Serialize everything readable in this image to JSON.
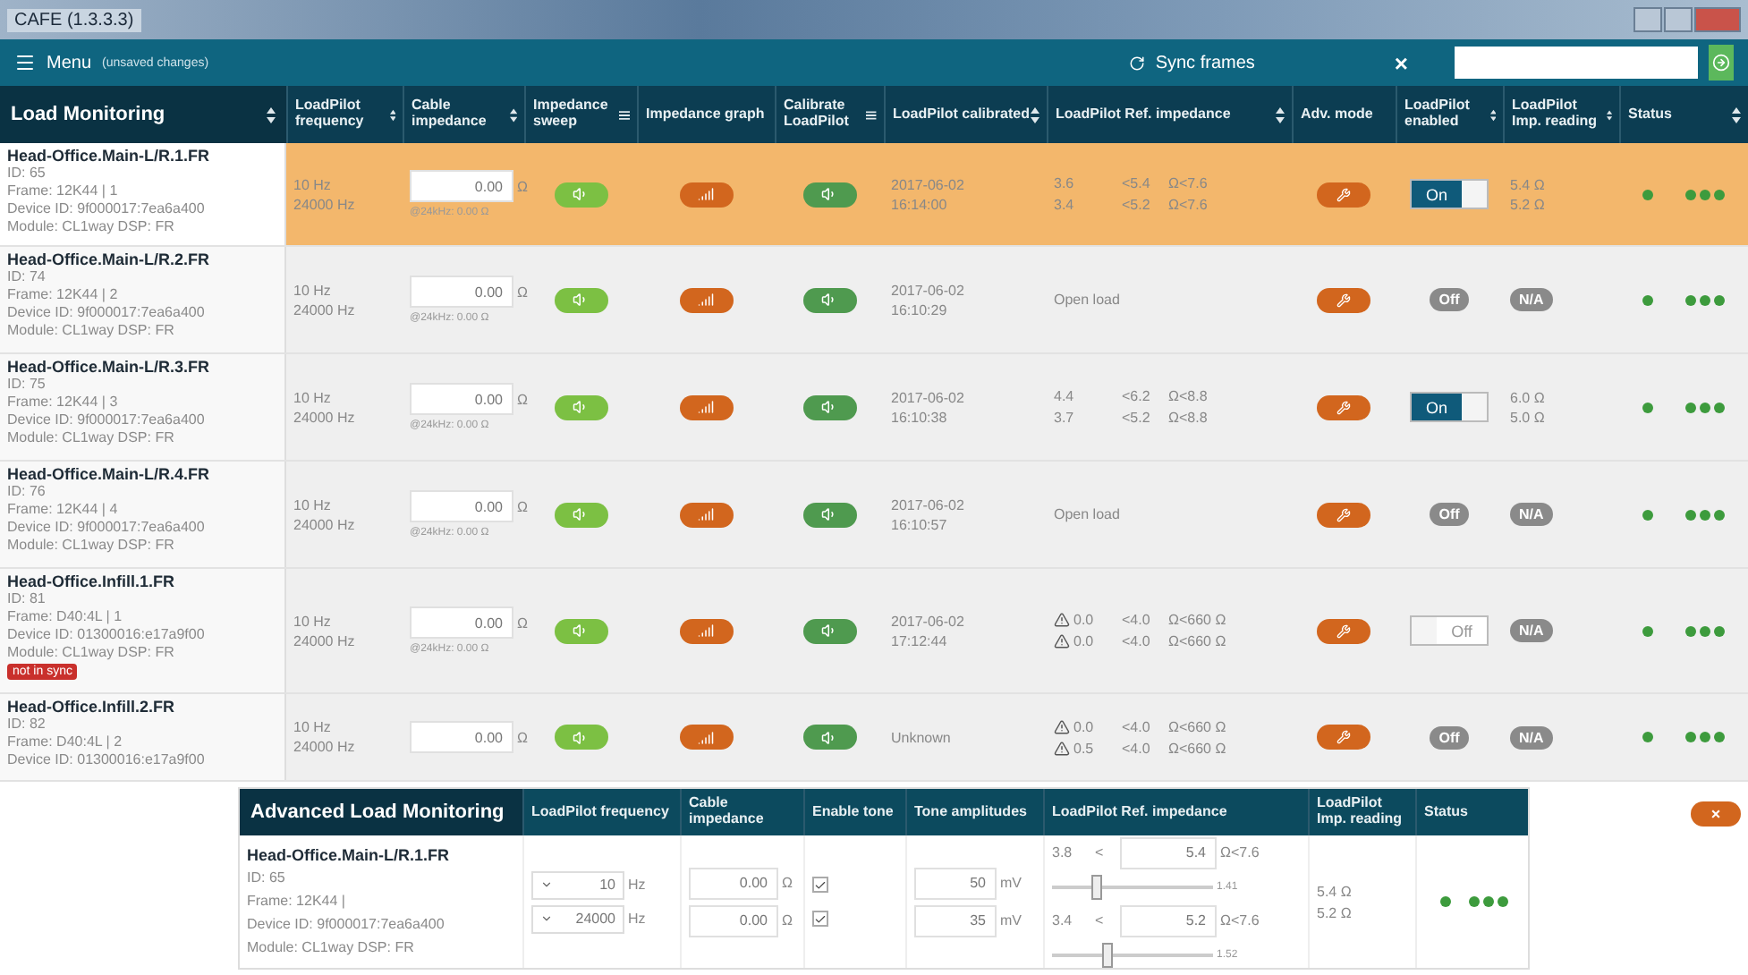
{
  "window": {
    "title": "CAFE (1.3.3.3)"
  },
  "toolbar": {
    "menu": "Menu",
    "note": "(unsaved changes)",
    "sync": "Sync frames",
    "clear": "×"
  },
  "table": {
    "title": "Load Monitoring",
    "columns": [
      {
        "label": "LoadPilot frequency",
        "kind": "sortable"
      },
      {
        "label": "Cable impedance",
        "kind": "sortable"
      },
      {
        "label": "Impedance sweep",
        "kind": "action"
      },
      {
        "label": "Impedance graph",
        "kind": "plain"
      },
      {
        "label": "Calibrate LoadPilot",
        "kind": "action"
      },
      {
        "label": "LoadPilot calibrated",
        "kind": "sortable"
      },
      {
        "label": "LoadPilot Ref. impedance",
        "kind": "sortable"
      },
      {
        "label": "Adv. mode",
        "kind": "plain"
      },
      {
        "label": "LoadPilot enabled",
        "kind": "sortable"
      },
      {
        "label": "LoadPilot Imp. reading",
        "kind": "sortable"
      },
      {
        "label": "Status",
        "kind": "sortable"
      }
    ],
    "rows": [
      {
        "selected": true,
        "name": "Head-Office.Main-L/R.1.FR",
        "details": [
          "ID: 65",
          "Frame: 12K44 | 1",
          "Device ID: 9f000017:7ea6a400",
          "Module: CL1way DSP: FR"
        ],
        "freq": [
          "10 Hz",
          "24000 Hz"
        ],
        "cable": "0.00",
        "cable_unit": "Ω",
        "cable_hint": "@24kHz: 0.00 Ω",
        "calibrated": [
          "2017-06-02",
          "16:14:00"
        ],
        "ref": {
          "kind": "values",
          "lines": [
            {
              "warn": false,
              "min": "3.6",
              "nom": "<5.4",
              "max": "Ω<7.6"
            },
            {
              "warn": false,
              "min": "3.4",
              "nom": "<5.2",
              "max": "Ω<7.6"
            }
          ]
        },
        "enabled": {
          "kind": "switch",
          "on": true,
          "label": "On"
        },
        "reading": {
          "kind": "values",
          "lines": [
            "5.4 Ω",
            "5.2 Ω"
          ]
        }
      },
      {
        "selected": false,
        "name": "Head-Office.Main-L/R.2.FR",
        "details": [
          "ID: 74",
          "Frame: 12K44 | 2",
          "Device ID: 9f000017:7ea6a400",
          "Module: CL1way DSP: FR"
        ],
        "freq": [
          "10 Hz",
          "24000 Hz"
        ],
        "cable": "0.00",
        "cable_unit": "Ω",
        "cable_hint": "@24kHz: 0.00 Ω",
        "calibrated": [
          "2017-06-02",
          "16:10:29"
        ],
        "ref": {
          "kind": "text",
          "text": "Open load"
        },
        "enabled": {
          "kind": "pill",
          "on": false,
          "label": "Off"
        },
        "reading": {
          "kind": "pill",
          "label": "N/A"
        }
      },
      {
        "selected": false,
        "name": "Head-Office.Main-L/R.3.FR",
        "details": [
          "ID: 75",
          "Frame: 12K44 | 3",
          "Device ID: 9f000017:7ea6a400",
          "Module: CL1way DSP: FR"
        ],
        "freq": [
          "10 Hz",
          "24000 Hz"
        ],
        "cable": "0.00",
        "cable_unit": "Ω",
        "cable_hint": "@24kHz: 0.00 Ω",
        "calibrated": [
          "2017-06-02",
          "16:10:38"
        ],
        "ref": {
          "kind": "values",
          "lines": [
            {
              "warn": false,
              "min": "4.4",
              "nom": "<6.2",
              "max": "Ω<8.8"
            },
            {
              "warn": false,
              "min": "3.7",
              "nom": "<5.2",
              "max": "Ω<8.8"
            }
          ]
        },
        "enabled": {
          "kind": "switch",
          "on": true,
          "label": "On"
        },
        "reading": {
          "kind": "values",
          "lines": [
            "6.0 Ω",
            "5.0 Ω"
          ]
        }
      },
      {
        "selected": false,
        "name": "Head-Office.Main-L/R.4.FR",
        "details": [
          "ID: 76",
          "Frame: 12K44 | 4",
          "Device ID: 9f000017:7ea6a400",
          "Module: CL1way DSP: FR"
        ],
        "freq": [
          "10 Hz",
          "24000 Hz"
        ],
        "cable": "0.00",
        "cable_unit": "Ω",
        "cable_hint": "@24kHz: 0.00 Ω",
        "calibrated": [
          "2017-06-02",
          "16:10:57"
        ],
        "ref": {
          "kind": "text",
          "text": "Open load"
        },
        "enabled": {
          "kind": "pill",
          "on": false,
          "label": "Off"
        },
        "reading": {
          "kind": "pill",
          "label": "N/A"
        }
      },
      {
        "selected": false,
        "name": "Head-Office.Infill.1.FR",
        "details": [
          "ID: 81",
          "Frame: D40:4L | 1",
          "Device ID: 01300016:e17a9f00",
          "Module: CL1way DSP: FR"
        ],
        "badge": "not in sync",
        "freq": [
          "10 Hz",
          "24000 Hz"
        ],
        "cable": "0.00",
        "cable_unit": "Ω",
        "cable_hint": "@24kHz: 0.00 Ω",
        "calibrated": [
          "2017-06-02",
          "17:12:44"
        ],
        "ref": {
          "kind": "values",
          "lines": [
            {
              "warn": true,
              "min": "0.0",
              "nom": "<4.0",
              "max": "Ω<660 Ω"
            },
            {
              "warn": true,
              "min": "0.0",
              "nom": "<4.0",
              "max": "Ω<660 Ω"
            }
          ]
        },
        "enabled": {
          "kind": "switch",
          "on": false,
          "label": "Off"
        },
        "reading": {
          "kind": "pill",
          "label": "N/A"
        }
      },
      {
        "selected": false,
        "name": "Head-Office.Infill.2.FR",
        "details": [
          "ID: 82",
          "Frame: D40:4L | 2",
          "Device ID: 01300016:e17a9f00"
        ],
        "freq": [
          "10 Hz",
          "24000 Hz"
        ],
        "cable": "0.00",
        "cable_unit": "Ω",
        "calibrated": [
          "Unknown"
        ],
        "ref": {
          "kind": "values",
          "lines": [
            {
              "warn": true,
              "min": "0.0",
              "nom": "<4.0",
              "max": "Ω<660 Ω"
            },
            {
              "warn": true,
              "min": "0.5",
              "nom": "<4.0",
              "max": "Ω<660 Ω"
            }
          ]
        },
        "enabled": {
          "kind": "pill",
          "on": false,
          "label": "Off"
        },
        "reading": {
          "kind": "pill",
          "label": "N/A"
        }
      }
    ]
  },
  "advanced": {
    "title": "Advanced Load Monitoring",
    "columns": [
      "LoadPilot frequency",
      "Cable impedance",
      "Enable tone",
      "Tone amplitudes",
      "LoadPilot Ref. impedance",
      "LoadPilot Imp. reading",
      "Status"
    ],
    "device": {
      "name": "Head-Office.Main-L/R.1.FR",
      "details": [
        "ID: 65",
        "Frame: 12K44 |",
        "Device ID: 9f000017:7ea6a400",
        "Module: CL1way DSP: FR"
      ]
    },
    "channels": [
      {
        "freq": "10",
        "freq_unit": "Hz",
        "cable": "0.00",
        "cable_unit": "Ω",
        "tone": true,
        "amp": "50",
        "amp_unit": "mV",
        "ref_min": "3.8",
        "ref_lt": "<",
        "ref_value": "5.4",
        "ref_max": "Ω<7.6",
        "level": 0.28,
        "slider_value": "1.41"
      },
      {
        "freq": "24000",
        "freq_unit": "Hz",
        "cable": "0.00",
        "cable_unit": "Ω",
        "tone": true,
        "amp": "35",
        "amp_unit": "mV",
        "ref_min": "3.4",
        "ref_lt": "<",
        "ref_value": "5.2",
        "ref_max": "Ω<7.6",
        "level": 0.34,
        "slider_value": "1.52"
      }
    ],
    "readings": [
      "5.4 Ω",
      "5.2 Ω"
    ],
    "close": "×"
  }
}
